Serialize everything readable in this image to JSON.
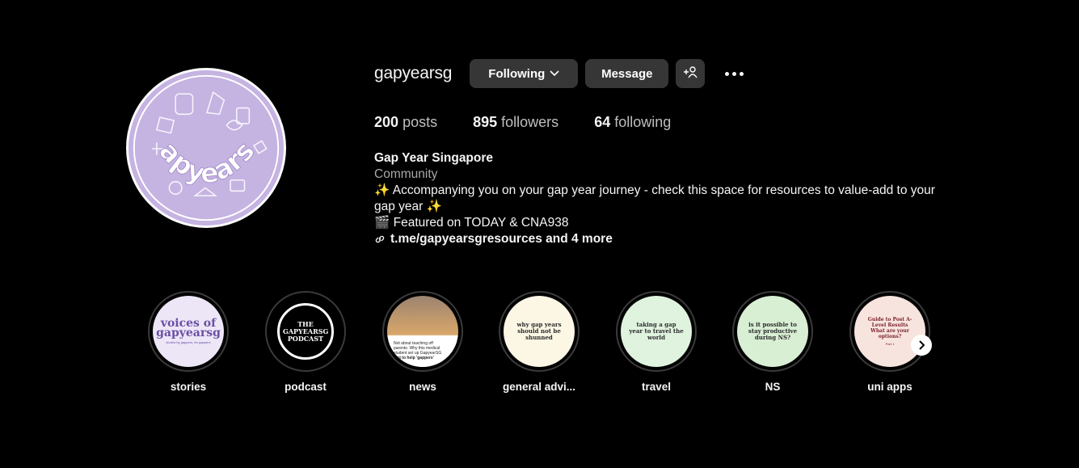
{
  "profile": {
    "username": "gapyearsg",
    "avatar_text": "gapyearsg",
    "buttons": {
      "following": "Following",
      "message": "Message"
    },
    "stats": {
      "posts_count": "200",
      "posts_label": "posts",
      "followers_count": "895",
      "followers_label": "followers",
      "following_count": "64",
      "following_label": "following"
    },
    "bio": {
      "name": "Gap Year Singapore",
      "category": "Community",
      "line1": "✨ Accompanying you on your gap year journey - check this space for resources to value-add to your gap year ✨",
      "line2": "🎬 Featured on TODAY & CNA938",
      "link": "t.me/gapyearsgresources and 4 more"
    }
  },
  "highlights": [
    {
      "label": "stories",
      "cover_title": "voices of gapyearsg",
      "cover_sub": "stories by gappers, for gappers",
      "bg": "#ede6f7"
    },
    {
      "label": "podcast",
      "cover_title": "THE GAPYEARSG PODCAST",
      "bg": "#000000"
    },
    {
      "label": "news",
      "cover_lines": [
        "Not about teaching off",
        "parents: Why this medical",
        "student set up GapyearSG",
        "just to help 'gappers'"
      ],
      "bg": "#8a6f5a"
    },
    {
      "label": "general advi...",
      "cover_title": "why gap years should not be shunned",
      "bg": "#fbf7e4"
    },
    {
      "label": "travel",
      "cover_title": "taking a gap year to travel the world",
      "bg": "#dff3df"
    },
    {
      "label": "NS",
      "cover_title": "is it possible to stay productive during NS?",
      "bg": "#d8efd4"
    },
    {
      "label": "uni apps",
      "cover_title": "Guide to Post A-Level Results",
      "cover_sub": "What are your options?",
      "cover_foot": "Part 1",
      "bg": "#f8e4de"
    }
  ],
  "colors": {
    "background": "#000000",
    "button": "#363636",
    "avatar_bg": "#c5b3e2",
    "muted_text": "#a8a8a8"
  },
  "icons": [
    "chevron-down-icon",
    "add-person-icon",
    "more-icon",
    "link-icon",
    "chevron-right-icon"
  ]
}
